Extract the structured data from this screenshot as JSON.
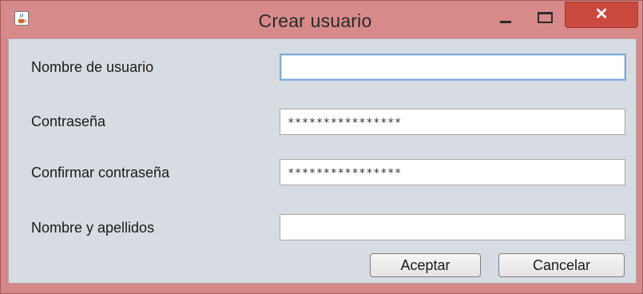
{
  "window": {
    "title": "Crear usuario",
    "icon": "java-cup-icon",
    "controls": {
      "minimize": "minimize-icon",
      "maximize": "maximize-icon",
      "close": "✕"
    }
  },
  "form": {
    "username_label": "Nombre de usuario",
    "username_value": "",
    "password_label": "Contraseña",
    "password_value": "****************",
    "confirm_label": "Confirmar contraseña",
    "confirm_value": "****************",
    "fullname_label": "Nombre y apellidos",
    "fullname_value": ""
  },
  "buttons": {
    "accept": "Aceptar",
    "cancel": "Cancelar"
  },
  "colors": {
    "titlebar": "#d88a8a",
    "close_button": "#c9493e",
    "content_bg": "#d7dce3",
    "focus_border": "#7fa8d6"
  }
}
